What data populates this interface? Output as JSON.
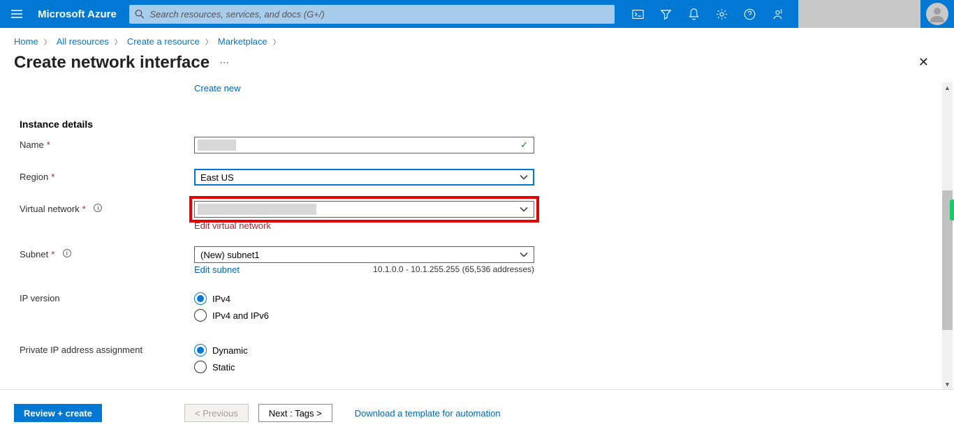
{
  "header": {
    "brand": "Microsoft Azure",
    "search_placeholder": "Search resources, services, and docs (G+/)"
  },
  "breadcrumb": {
    "items": [
      "Home",
      "All resources",
      "Create a resource",
      "Marketplace"
    ]
  },
  "page": {
    "title": "Create network interface"
  },
  "form": {
    "create_new_link": "Create new",
    "section_instance": "Instance details",
    "name": {
      "label": "Name",
      "value": ""
    },
    "region": {
      "label": "Region",
      "value": "East US"
    },
    "vnet": {
      "label": "Virtual network",
      "value": "",
      "edit_link": "Edit virtual network"
    },
    "subnet": {
      "label": "Subnet",
      "value": "(New) subnet1",
      "edit_link": "Edit subnet",
      "range": "10.1.0.0 - 10.1.255.255 (65,536 addresses)"
    },
    "ipversion": {
      "label": "IP version",
      "opt1": "IPv4",
      "opt2": "IPv4 and IPv6"
    },
    "pipassign": {
      "label": "Private IP address assignment",
      "opt1": "Dynamic",
      "opt2": "Static"
    }
  },
  "footer": {
    "review": "Review + create",
    "previous": "< Previous",
    "next": "Next : Tags >",
    "download": "Download a template for automation"
  }
}
